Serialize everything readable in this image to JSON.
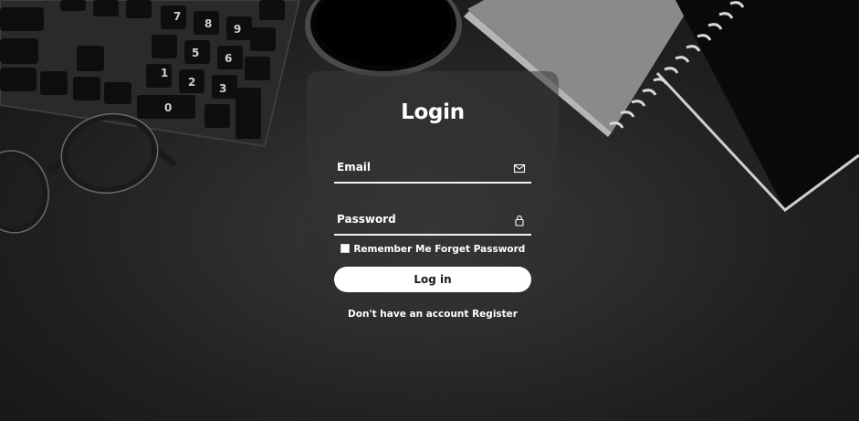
{
  "form": {
    "title": "Login",
    "email": {
      "placeholder": "Email",
      "icon": "envelope-icon"
    },
    "password": {
      "placeholder": "Password",
      "icon": "lock-icon"
    },
    "remember_label": "Remember Me",
    "forgot_label": "Forget Password",
    "login_label": "Log in",
    "no_account_text": "Don't have an account",
    "register_label": "Register"
  },
  "colors": {
    "background": "#1c1c1c",
    "text": "#ffffff",
    "button_bg": "#ffffff",
    "button_text": "#1a1a1a"
  }
}
